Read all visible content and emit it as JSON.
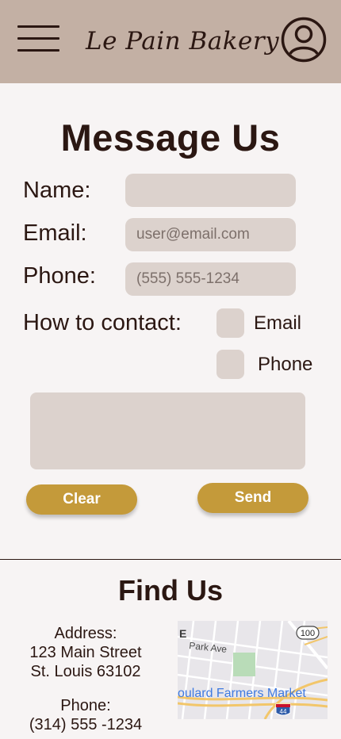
{
  "header": {
    "brand": "Le Pain Bakery",
    "menu_icon": "hamburger-menu-icon",
    "profile_icon": "user-account-icon"
  },
  "form": {
    "title": "Message Us",
    "name_label": "Name:",
    "name_value": "",
    "email_label": "Email:",
    "email_placeholder": "user@email.com",
    "phone_label": "Phone:",
    "phone_placeholder": "(555) 555-1234",
    "contact_label": "How to contact:",
    "contact_options": [
      "Email",
      "Phone"
    ],
    "message_value": "",
    "clear_label": "Clear",
    "send_label": "Send"
  },
  "find_us": {
    "title": "Find Us",
    "address_label": "Address:",
    "address_line1": "123 Main Street",
    "address_line2": "St. Louis 63102",
    "phone_label": "Phone:",
    "phone_value": "(314) 555 -1234",
    "map": {
      "street_label": "Park Ave",
      "place_label": "oulard Farmers Market",
      "route_shield_1": "100",
      "route_shield_2": "44",
      "edge_letter": "E"
    }
  },
  "colors": {
    "header_bg": "#c3b0a4",
    "page_bg": "#f7f4f4",
    "field_bg": "#dcd2cd",
    "button_bg": "#c49a3a",
    "text": "#2b1712"
  }
}
